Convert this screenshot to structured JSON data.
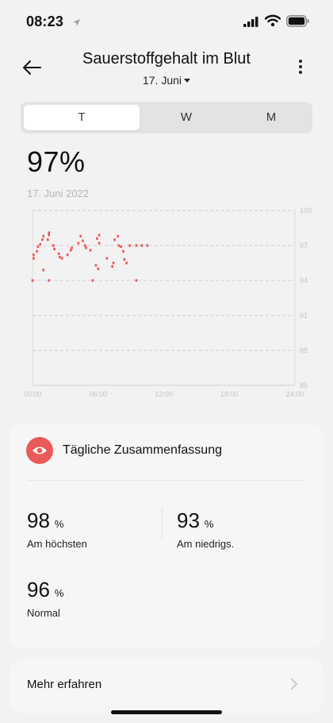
{
  "status_bar": {
    "time": "08:23"
  },
  "header": {
    "title": "Sauerstoffgehalt im Blut",
    "date_select": "17. Juni"
  },
  "tabs": [
    {
      "label": "T",
      "active": true
    },
    {
      "label": "W",
      "active": false
    },
    {
      "label": "M",
      "active": false
    }
  ],
  "current": {
    "value": "97%",
    "date": "17. Juni 2022"
  },
  "colors": {
    "accent": "#ea5a5a",
    "chart_points": "#f05454"
  },
  "chart_data": {
    "type": "scatter",
    "title": "",
    "xlabel": "",
    "ylabel": "",
    "xlim": [
      0,
      24
    ],
    "ylim": [
      85,
      100
    ],
    "x_ticks": [
      "00:00",
      "06:00",
      "12:00",
      "18:00",
      "24:00"
    ],
    "y_ticks": [
      "100",
      "97",
      "94",
      "91",
      "88",
      "85"
    ],
    "grid": true,
    "series": [
      {
        "values": [
          [
            0.1,
            95.9
          ],
          [
            0.1,
            96.2
          ],
          [
            0.4,
            96.5
          ],
          [
            0.5,
            96.9
          ],
          [
            0.7,
            97.1
          ],
          [
            0.9,
            97.5
          ],
          [
            1.0,
            97.8
          ],
          [
            1.4,
            97.5
          ],
          [
            1.5,
            97.9
          ],
          [
            1.5,
            98.1
          ],
          [
            1.9,
            97.0
          ],
          [
            2.0,
            96.7
          ],
          [
            2.4,
            96.3
          ],
          [
            2.5,
            96.0
          ],
          [
            2.7,
            95.9
          ],
          [
            3.2,
            96.2
          ],
          [
            3.5,
            96.6
          ],
          [
            3.6,
            96.8
          ],
          [
            4.2,
            97.2
          ],
          [
            4.4,
            97.8
          ],
          [
            4.6,
            97.4
          ],
          [
            4.8,
            97.0
          ],
          [
            4.9,
            96.8
          ],
          [
            5.3,
            96.6
          ],
          [
            5.9,
            97.6
          ],
          [
            6.1,
            97.9
          ],
          [
            6.1,
            97.2
          ],
          [
            6.8,
            95.9
          ],
          [
            7.3,
            95.2
          ],
          [
            7.4,
            95.5
          ],
          [
            6.0,
            95.0
          ],
          [
            5.8,
            95.3
          ],
          [
            7.5,
            97.5
          ],
          [
            7.8,
            97.8
          ],
          [
            7.9,
            97.0
          ],
          [
            8.1,
            96.9
          ],
          [
            8.4,
            95.8
          ],
          [
            8.6,
            95.5
          ],
          [
            8.3,
            96.5
          ],
          [
            8.9,
            97.0
          ],
          [
            9.5,
            97.0
          ],
          [
            10.0,
            97.0
          ],
          [
            10.5,
            97.0
          ],
          [
            1.0,
            94.9
          ],
          [
            0.0,
            94.0
          ],
          [
            1.5,
            94.0
          ],
          [
            5.5,
            94.0
          ],
          [
            9.5,
            94.0
          ]
        ]
      }
    ]
  },
  "summary": {
    "title": "Tägliche Zusammenfassung",
    "highest": {
      "value": "98",
      "unit": "%",
      "label": "Am höchsten"
    },
    "lowest": {
      "value": "93",
      "unit": "%",
      "label": "Am niedrigs."
    },
    "normal": {
      "value": "96",
      "unit": "%",
      "label": "Normal"
    }
  },
  "more": {
    "label": "Mehr erfahren"
  }
}
